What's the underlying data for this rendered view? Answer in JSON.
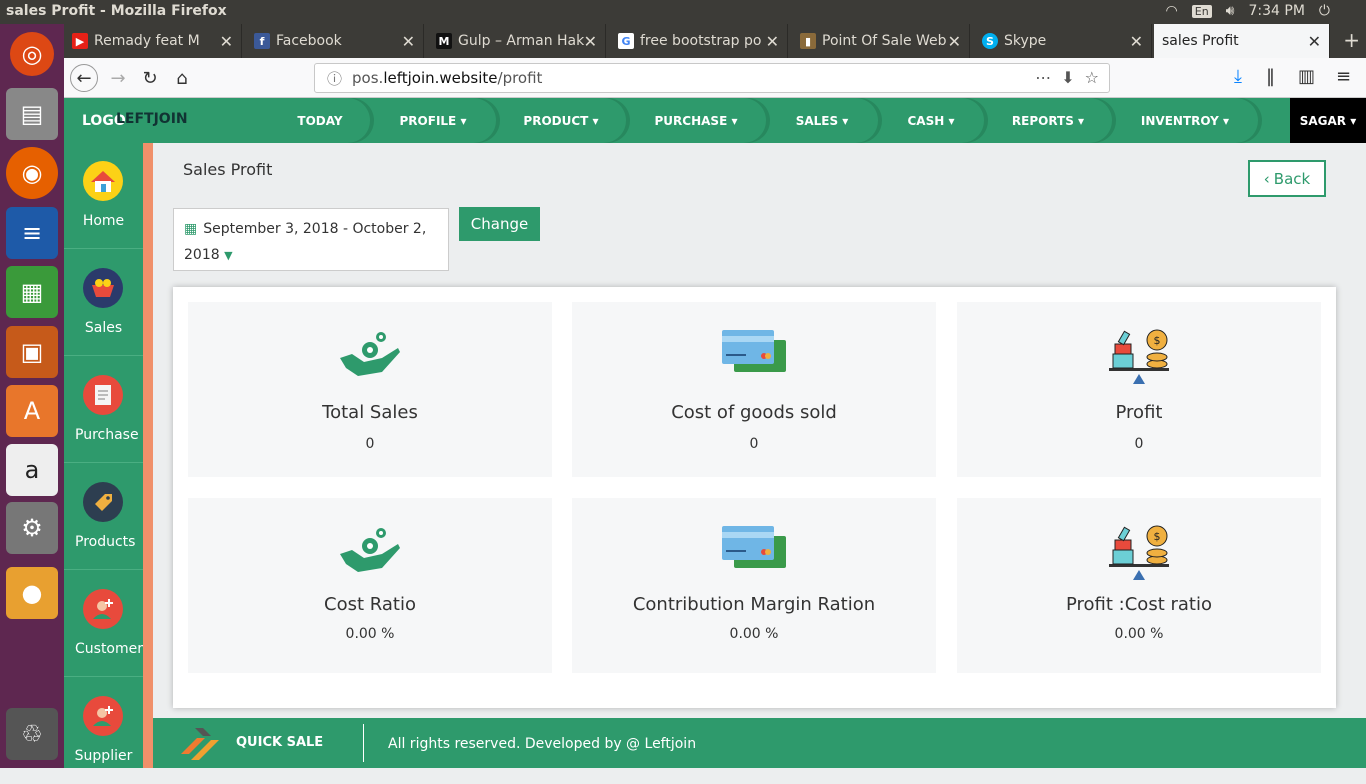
{
  "os": {
    "window_title": "sales Profit - Mozilla Firefox",
    "keyboard_layout": "En",
    "clock": "7:34 PM"
  },
  "browser": {
    "tabs": [
      {
        "label": "Remady feat M",
        "icon": "youtube-icon"
      },
      {
        "label": "Facebook",
        "icon": "facebook-icon"
      },
      {
        "label": "Gulp – Arman Hak",
        "icon": "medium-icon"
      },
      {
        "label": "free bootstrap po",
        "icon": "google-icon"
      },
      {
        "label": "Point Of Sale Web",
        "icon": "bookmark-icon"
      },
      {
        "label": "Skype",
        "icon": "skype-icon"
      },
      {
        "label": "sales Profit",
        "icon": ""
      }
    ],
    "url_domain": "pos.leftjoin.website",
    "url_path": "/profit",
    "url_prefix": "pos."
  },
  "topnav": {
    "logo": "LOGO",
    "brand": "LEFTJOIN",
    "items": [
      "TODAY",
      "PROFILE",
      "PRODUCT",
      "PURCHASE",
      "SALES",
      "CASH",
      "REPORTS",
      "INVENTROY"
    ],
    "user": "SAGAR"
  },
  "sidebar": {
    "items": [
      "Home",
      "Sales",
      "Purchase",
      "Products",
      "Customer",
      "Supplier"
    ]
  },
  "page": {
    "title": "Sales Profit",
    "back_label": "Back",
    "date_range_line1": "September 3, 2018 - October 2,",
    "date_range_line2": "2018",
    "change_label": "Change"
  },
  "cards": [
    {
      "title": "Total Sales",
      "value": "0",
      "icon": "money-hand-icon"
    },
    {
      "title": "Cost of goods sold",
      "value": "0",
      "icon": "credit-cards-icon"
    },
    {
      "title": "Profit",
      "value": "0",
      "icon": "balance-scale-icon"
    },
    {
      "title": "Cost Ratio",
      "value": "0.00 %",
      "icon": "money-hand-icon"
    },
    {
      "title": "Contribution Margin Ration",
      "value": "0.00 %",
      "icon": "credit-cards-icon"
    },
    {
      "title": "Profit :Cost ratio",
      "value": "0.00 %",
      "icon": "balance-scale-icon"
    }
  ],
  "footer": {
    "brand": "QUICK SALE",
    "copyright": "All rights reserved. Developed by @ Leftjoin"
  },
  "colors": {
    "primary": "#2e9a6c",
    "accent_stripe": "#f0906a",
    "launcher": "#5e2750"
  }
}
